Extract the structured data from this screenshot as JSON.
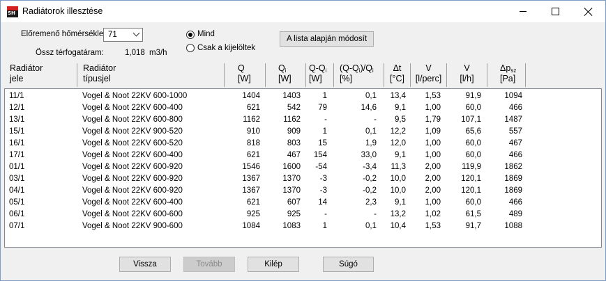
{
  "window": {
    "title": "Radiátorok illesztése",
    "icon": "app-logo-icon"
  },
  "controls": {
    "temp_label": "Előremenő hőmérséklet:",
    "temp_value": "71",
    "flow_label": "Össz térfogatáram:",
    "flow_value": "1,018",
    "flow_unit": "m3/h",
    "radio_all": "Mind",
    "radio_selected": "Csak a kijelöltek",
    "radio_checked": "all",
    "modify_button": "A lista alapján módosít"
  },
  "columns": [
    {
      "l1": "Radiátor",
      "l2": "jele"
    },
    {
      "l1": "Radiátor",
      "l2": "típusjel"
    },
    {
      "l1": "Q",
      "l2": "[W]"
    },
    {
      "l1": "Q",
      "l1_sub": "i",
      "l2": "[W]"
    },
    {
      "l1": "Q-Q",
      "l1_sub": "i",
      "l2": "[W]"
    },
    {
      "l1": "(Q-Q",
      "l1_sub": "i",
      "l1_post": ")/Q",
      "l1_sub2": "i",
      "l2": "[%]"
    },
    {
      "l1": "Δt",
      "l2": "[°C]"
    },
    {
      "l1": "V",
      "l2": "[l/perc]"
    },
    {
      "l1": "V",
      "l2": "[l/h]"
    },
    {
      "l1": "Δp",
      "l1_sub": "sz",
      "l2": "[Pa]"
    }
  ],
  "rows": [
    [
      "11/1",
      "Vogel & Noot 22KV 600-1000",
      "1404",
      "1403",
      "1",
      "0,1",
      "13,4",
      "1,53",
      "91,9",
      "1094"
    ],
    [
      "12/1",
      "Vogel & Noot 22KV 600-400",
      "621",
      "542",
      "79",
      "14,6",
      "9,1",
      "1,00",
      "60,0",
      "466"
    ],
    [
      "13/1",
      "Vogel & Noot 22KV 600-800",
      "1162",
      "1162",
      "-",
      "-",
      "9,5",
      "1,79",
      "107,1",
      "1487"
    ],
    [
      "15/1",
      "Vogel & Noot 22KV 900-520",
      "910",
      "909",
      "1",
      "0,1",
      "12,2",
      "1,09",
      "65,6",
      "557"
    ],
    [
      "16/1",
      "Vogel & Noot 22KV 600-520",
      "818",
      "803",
      "15",
      "1,9",
      "12,0",
      "1,00",
      "60,0",
      "467"
    ],
    [
      "17/1",
      "Vogel & Noot 22KV 600-400",
      "621",
      "467",
      "154",
      "33,0",
      "9,1",
      "1,00",
      "60,0",
      "466"
    ],
    [
      "01/1",
      "Vogel & Noot 22KV 600-920",
      "1546",
      "1600",
      "-54",
      "-3,4",
      "11,3",
      "2,00",
      "119,9",
      "1862"
    ],
    [
      "03/1",
      "Vogel & Noot 22KV 600-920",
      "1367",
      "1370",
      "-3",
      "-0,2",
      "10,0",
      "2,00",
      "120,1",
      "1869"
    ],
    [
      "04/1",
      "Vogel & Noot 22KV 600-920",
      "1367",
      "1370",
      "-3",
      "-0,2",
      "10,0",
      "2,00",
      "120,1",
      "1869"
    ],
    [
      "05/1",
      "Vogel & Noot 22KV 600-400",
      "621",
      "607",
      "14",
      "2,3",
      "9,1",
      "1,00",
      "60,0",
      "466"
    ],
    [
      "06/1",
      "Vogel & Noot 22KV 600-600",
      "925",
      "925",
      "-",
      "-",
      "13,2",
      "1,02",
      "61,5",
      "489"
    ],
    [
      "07/1",
      "Vogel & Noot 22KV 900-600",
      "1084",
      "1083",
      "1",
      "0,1",
      "10,4",
      "1,53",
      "91,7",
      "1088"
    ]
  ],
  "buttons": {
    "back": "Vissza",
    "next": "Tovább",
    "exit": "Kilép",
    "help": "Súgó"
  }
}
